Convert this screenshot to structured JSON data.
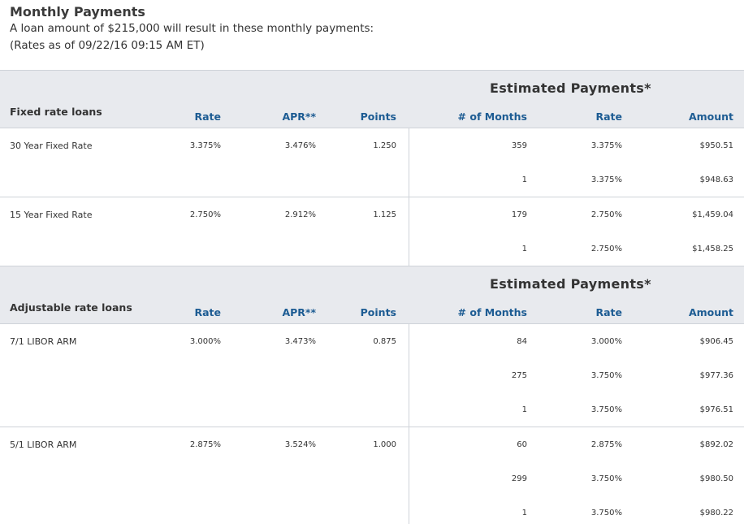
{
  "header": {
    "title": "Monthly Payments",
    "line1": "A loan amount of $215,000 will result in these monthly payments:",
    "line2": "(Rates as of 09/22/16 09:15 AM ET)"
  },
  "colors": {
    "header_bg": "#e8eaee",
    "accent_blue": "#1d5c93",
    "divider": "#cfd3d9"
  },
  "columns": {
    "rate": "Rate",
    "apr": "APR**",
    "points": "Points",
    "months": "# of Months",
    "est_rate": "Rate",
    "amount": "Amount"
  },
  "fixed": {
    "section_label": "Fixed rate loans",
    "estimated_title": "Estimated Payments*",
    "loans": [
      {
        "name": "30 Year Fixed Rate",
        "rate": "3.375%",
        "apr": "3.476%",
        "points": "1.250",
        "payments": [
          {
            "months": "359",
            "rate": "3.375%",
            "amount": "$950.51"
          },
          {
            "months": "1",
            "rate": "3.375%",
            "amount": "$948.63"
          }
        ]
      },
      {
        "name": "15 Year Fixed Rate",
        "rate": "2.750%",
        "apr": "2.912%",
        "points": "1.125",
        "payments": [
          {
            "months": "179",
            "rate": "2.750%",
            "amount": "$1,459.04"
          },
          {
            "months": "1",
            "rate": "2.750%",
            "amount": "$1,458.25"
          }
        ]
      }
    ]
  },
  "adjustable": {
    "section_label": "Adjustable rate loans",
    "estimated_title": "Estimated Payments*",
    "loans": [
      {
        "name": "7/1 LIBOR ARM",
        "rate": "3.000%",
        "apr": "3.473%",
        "points": "0.875",
        "payments": [
          {
            "months": "84",
            "rate": "3.000%",
            "amount": "$906.45"
          },
          {
            "months": "275",
            "rate": "3.750%",
            "amount": "$977.36"
          },
          {
            "months": "1",
            "rate": "3.750%",
            "amount": "$976.51"
          }
        ]
      },
      {
        "name": "5/1 LIBOR ARM",
        "rate": "2.875%",
        "apr": "3.524%",
        "points": "1.000",
        "payments": [
          {
            "months": "60",
            "rate": "2.875%",
            "amount": "$892.02"
          },
          {
            "months": "299",
            "rate": "3.750%",
            "amount": "$980.50"
          },
          {
            "months": "1",
            "rate": "3.750%",
            "amount": "$980.22"
          }
        ]
      }
    ]
  }
}
